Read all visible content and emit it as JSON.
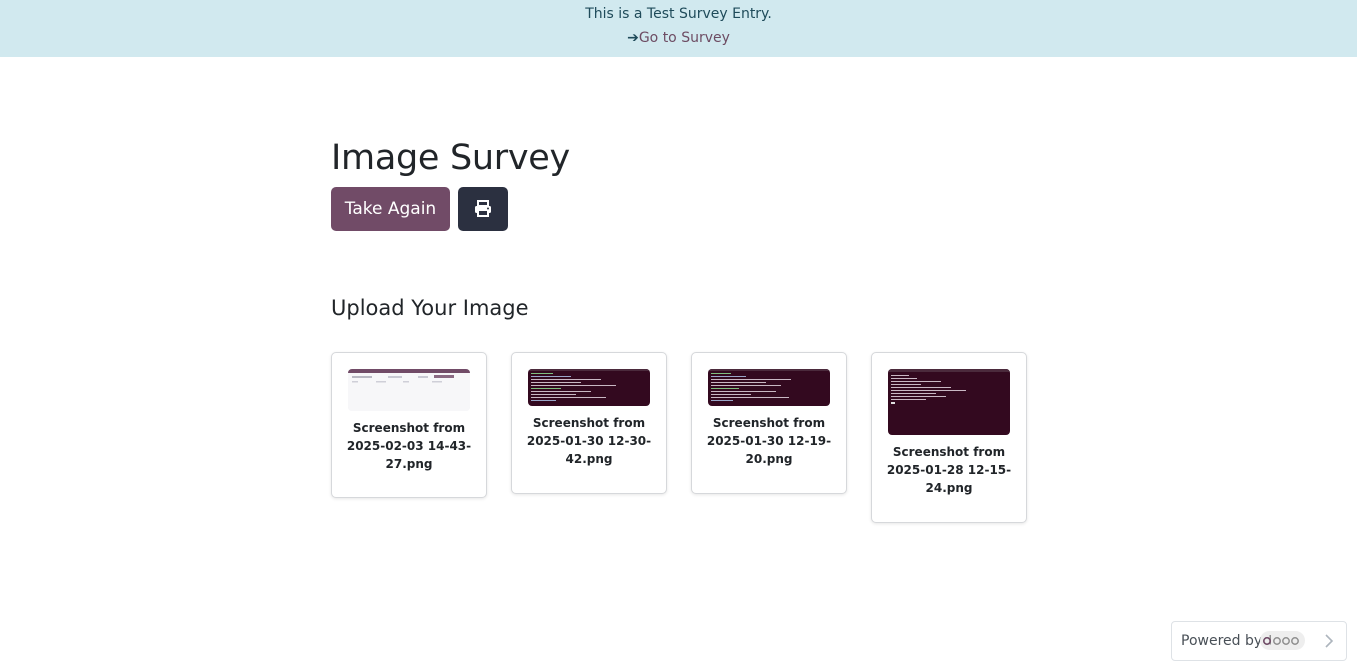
{
  "banner": {
    "message": "This is a Test Survey Entry.",
    "link_arrow": "➔",
    "link_label": "Go to Survey",
    "bg_color": "#d1e9ef"
  },
  "survey": {
    "title": "Image Survey",
    "take_again_label": "Take Again",
    "print_icon": "print-icon",
    "accent_color": "#714b67"
  },
  "question": {
    "title": "Upload Your Image",
    "files": [
      {
        "name": "Screenshot from 2025-02-03 14-43-27.png",
        "line1": "Screenshot from",
        "line2": "2025-02-03 14-43-",
        "line3": "27.png",
        "thumbnail": "light"
      },
      {
        "name": "Screenshot from 2025-01-30 12-30-42.png",
        "line1": "Screenshot from",
        "line2": "2025-01-30 12-30-",
        "line3": "42.png",
        "thumbnail": "dark"
      },
      {
        "name": "Screenshot from 2025-01-30 12-19-20.png",
        "line1": "Screenshot from",
        "line2": "2025-01-30 12-19-",
        "line3": "20.png",
        "thumbnail": "dark"
      },
      {
        "name": "Screenshot from 2025-01-28 12-15-24.png",
        "line1": "Screenshot from",
        "line2": "2025-01-28 12-15-",
        "line3": "24.png",
        "thumbnail": "dark"
      }
    ]
  },
  "footer": {
    "powered_by": "Powered by",
    "logo_text": "odoo",
    "chevron_icon": "chevron-right-icon"
  }
}
